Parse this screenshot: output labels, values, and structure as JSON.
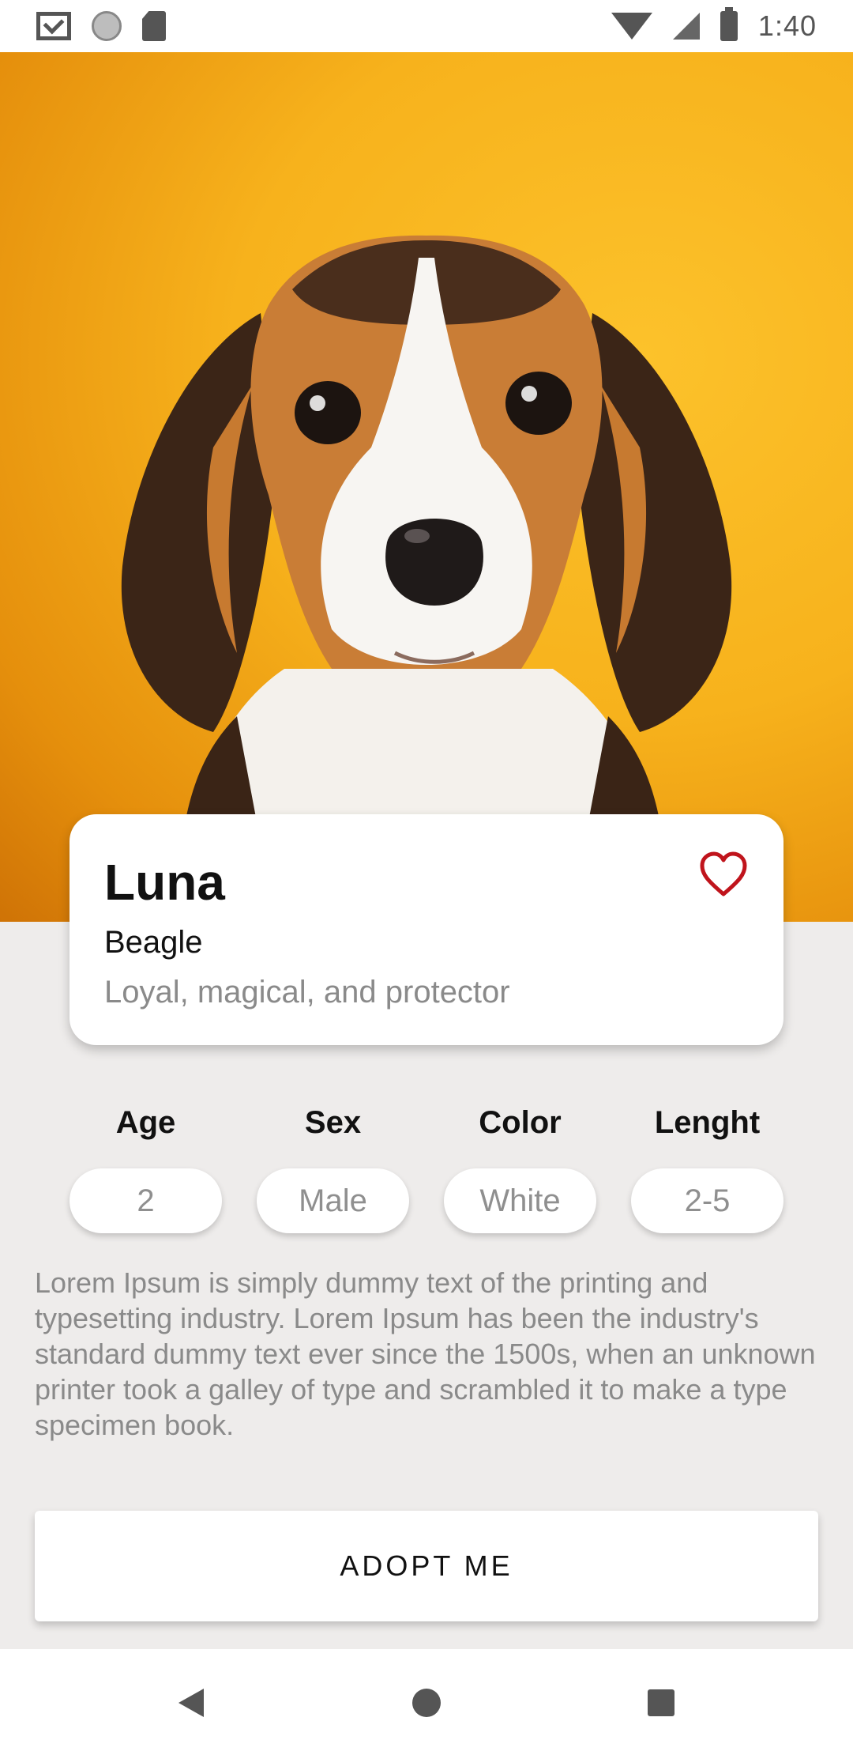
{
  "status_bar": {
    "time": "1:40",
    "left_icons": [
      "gmail-icon",
      "sync-icon",
      "sd-card-icon"
    ],
    "right_icons": [
      "wifi-icon",
      "signal-icon",
      "battery-icon"
    ]
  },
  "hero": {
    "image": "beagle-puppy-photo",
    "background_color": "#f7b21c"
  },
  "pet": {
    "name": "Luna",
    "breed": "Beagle",
    "tagline": "Loyal, magical, and protector",
    "favorite_icon": "heart-outline-icon",
    "favorite_color": "#c0141c"
  },
  "attributes": [
    {
      "label": "Age",
      "value": "2"
    },
    {
      "label": "Sex",
      "value": "Male"
    },
    {
      "label": "Color",
      "value": "White"
    },
    {
      "label": "Lenght",
      "value": "2-5"
    }
  ],
  "description": "Lorem Ipsum is simply dummy text of the printing and typesetting industry. Lorem Ipsum has been the industry's standard dummy text ever since the 1500s, when an unknown printer took a galley of type and scrambled it to make a type specimen book.",
  "actions": {
    "adopt_label": "ADOPT ME"
  },
  "nav_bar": {
    "buttons": [
      "back-icon",
      "home-icon",
      "recents-icon"
    ]
  }
}
